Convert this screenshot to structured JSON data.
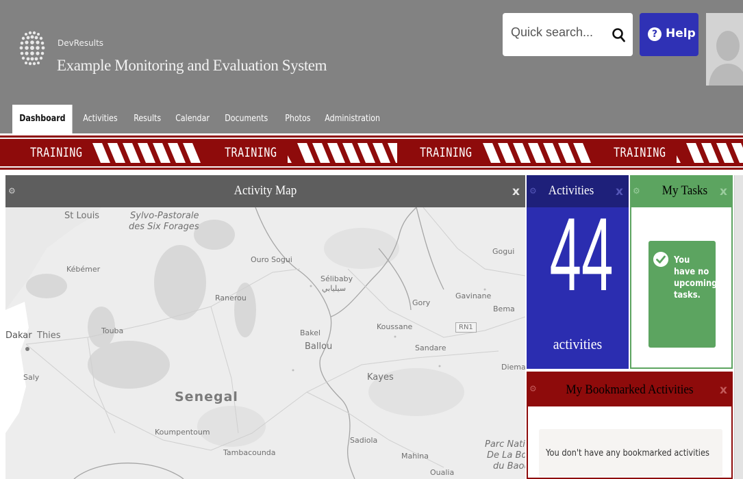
{
  "header": {
    "app_name": "DevResults",
    "app_title": "Example Monitoring and Evaluation System",
    "search": {
      "placeholder": "Quick search...",
      "value": ""
    },
    "help_label": "Help",
    "help_glyph": "?"
  },
  "nav": {
    "tabs": [
      {
        "label": "Dashboard",
        "active": true
      },
      {
        "label": "Activities"
      },
      {
        "label": "Results"
      },
      {
        "label": "Calendar"
      },
      {
        "label": "Documents"
      },
      {
        "label": "Photos"
      },
      {
        "label": "Administration"
      }
    ]
  },
  "banner": {
    "label": "TRAINING",
    "colors": {
      "background": "#8e0b0b",
      "stripe": "#ffffff"
    }
  },
  "activity_map": {
    "title": "Activity Map",
    "labels": {
      "st_louis": "St Louis",
      "sylvo": "Sylvo-Pastorale",
      "six_forages": "des Six Forages",
      "kebemer": "Kébémer",
      "ouro_sogui": "Ouro Sogui",
      "selibaby": "Sélibaby",
      "selibaby_ar": "سيليابي",
      "ranerou": "Ranerou",
      "gogui": "Gogui",
      "gory": "Gory",
      "gavinane": "Gavinane",
      "bema": "Bema",
      "dakar": "Dakar",
      "thies": "Thies",
      "touba": "Touba",
      "bakel": "Bakel",
      "ballou": "Ballou",
      "koussane": "Koussane",
      "rn1": "RN1",
      "sandare": "Sandare",
      "diema": "Diema",
      "saly": "Saly",
      "kayes": "Kayes",
      "senegal": "Senegal",
      "koumpentoum": "Koumpentoum",
      "sadiola": "Sadiola",
      "tambacounda": "Tambacounda",
      "mahina": "Mahina",
      "parc_1": "Parc Natio",
      "parc_2": "De La Bou",
      "parc_3": "du Baoul",
      "oualia": "Oualia"
    }
  },
  "activities_widget": {
    "title": "Activities",
    "count": "44",
    "unit": "activities",
    "color": "#2b2db0"
  },
  "tasks_widget": {
    "title": "My Tasks",
    "message": "You have no upcoming tasks.",
    "color": "#5ca460"
  },
  "bookmarks_widget": {
    "title": "My Bookmarked Activities",
    "empty_message": "You don't have any bookmarked activities",
    "color": "#8e0b0b"
  },
  "panel_controls": {
    "close_glyph": "x",
    "settings_glyph": "⚙"
  }
}
